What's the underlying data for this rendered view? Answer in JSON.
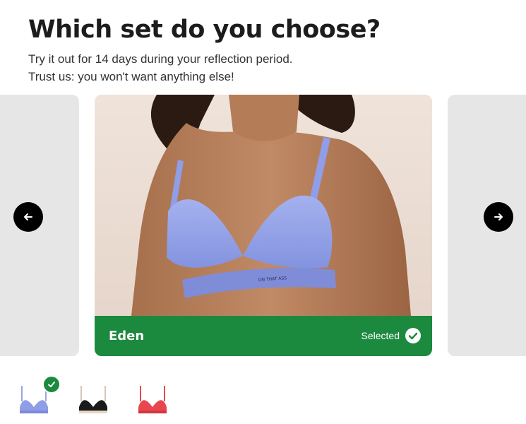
{
  "header": {
    "title": "Which set do you choose?",
    "subtitle_line1": "Try it out for 14 days during your reflection period.",
    "subtitle_line2": "Trust us: you won't want anything else!"
  },
  "carousel": {
    "prev_icon": "arrow-left-icon",
    "next_icon": "arrow-right-icon",
    "card": {
      "name": "Eden",
      "selected_label": "Selected",
      "band_text": "ON THAT ASS",
      "colors": {
        "bra": "#8f9ee6",
        "footer": "#1c8a3e"
      }
    }
  },
  "thumbnails": [
    {
      "name": "Eden lavender",
      "color": "#8f9ee6",
      "selected": true
    },
    {
      "name": "Black",
      "color": "#1a1a1a",
      "selected": false
    },
    {
      "name": "Red",
      "color": "#e8474f",
      "selected": false
    }
  ],
  "colors": {
    "accent": "#1c8a3e",
    "nav_button": "#000000",
    "side_card": "#e6e6e6"
  }
}
